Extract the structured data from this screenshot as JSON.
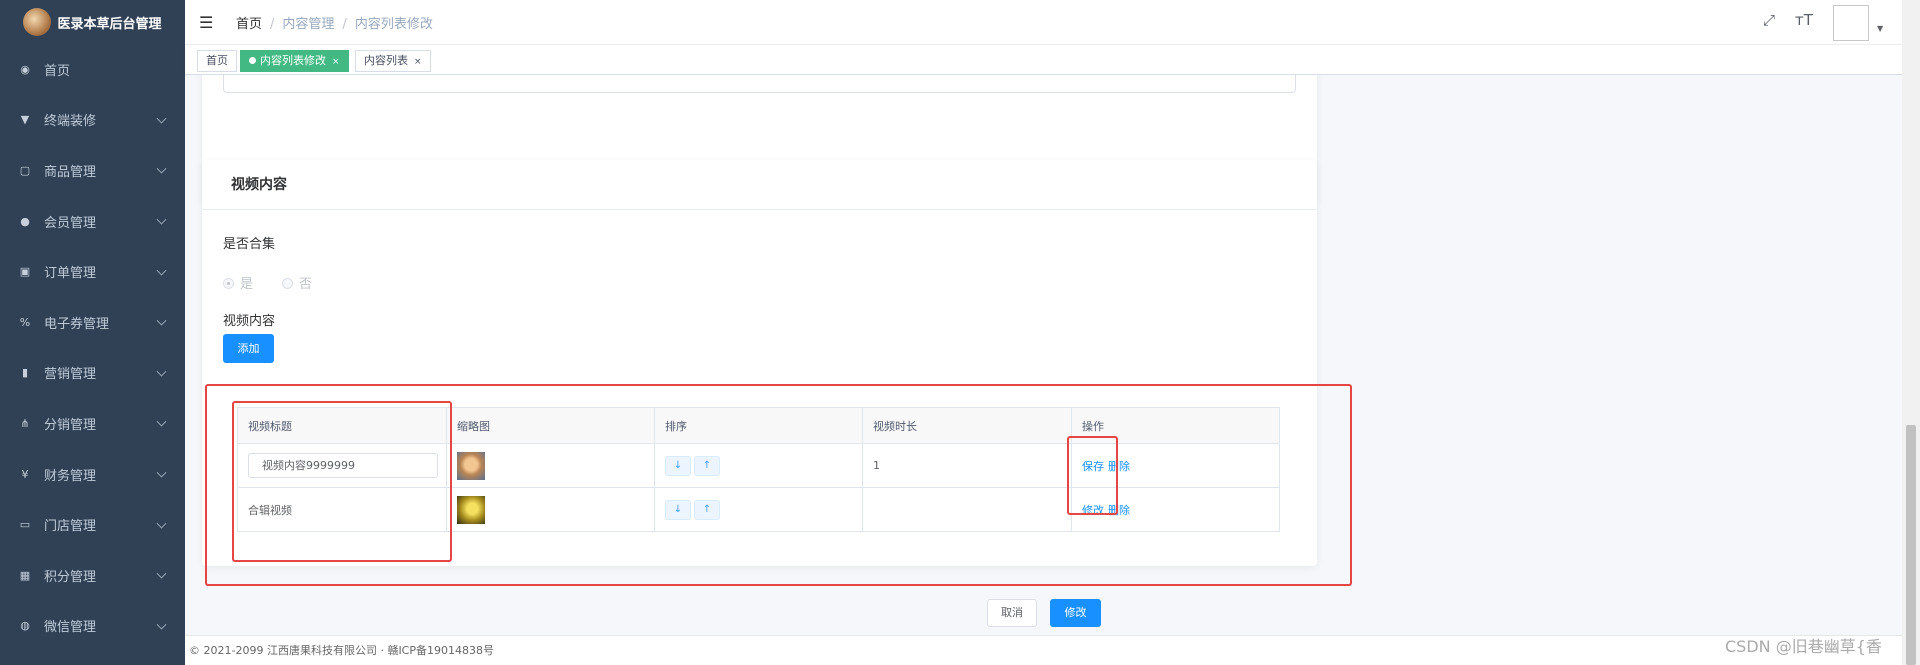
{
  "sidebar": {
    "title": "医录本草后台管理",
    "items": [
      {
        "label": "首页",
        "icon": "dashboard-icon",
        "glyph": "◉"
      },
      {
        "label": "终端装修",
        "icon": "shirt-icon",
        "glyph": "▼"
      },
      {
        "label": "商品管理",
        "icon": "goods-icon",
        "glyph": "▢"
      },
      {
        "label": "会员管理",
        "icon": "users-icon",
        "glyph": "●"
      },
      {
        "label": "订单管理",
        "icon": "lock-icon",
        "glyph": "▣"
      },
      {
        "label": "电子券管理",
        "icon": "coupon-icon",
        "glyph": "%"
      },
      {
        "label": "营销管理",
        "icon": "bar-chart-icon",
        "glyph": "▮"
      },
      {
        "label": "分销管理",
        "icon": "share-icon",
        "glyph": "⋔"
      },
      {
        "label": "财务管理",
        "icon": "finance-icon",
        "glyph": "¥"
      },
      {
        "label": "门店管理",
        "icon": "store-icon",
        "glyph": "▭"
      },
      {
        "label": "积分管理",
        "icon": "calendar-icon",
        "glyph": "▦"
      },
      {
        "label": "微信管理",
        "icon": "wechat-icon",
        "glyph": "◍"
      }
    ]
  },
  "navbar": {
    "breadcrumb": [
      "首页",
      "内容管理",
      "内容列表修改"
    ],
    "icons": [
      "fullscreen-icon",
      "font-size-icon"
    ],
    "fullscreen_glyph": "⤢",
    "fontsize_glyph": "тT",
    "caret_glyph": "▼"
  },
  "tags": [
    {
      "label": "首页",
      "active": false
    },
    {
      "label": "内容列表修改",
      "active": true,
      "close": "×"
    },
    {
      "label": "内容列表",
      "active": false,
      "close": "×"
    }
  ],
  "video_section": {
    "title": "视频内容",
    "collection_label": "是否合集",
    "radio_yes": "是",
    "radio_no": "否",
    "content_label": "视频内容",
    "add_button": "添加",
    "table": {
      "headers": [
        "视频标题",
        "缩略图",
        "排序",
        "视频时长",
        "操作"
      ],
      "rows": [
        {
          "title": "视频内容9999999",
          "editable": true,
          "duration": "1",
          "action1": "保存",
          "action2": "删除"
        },
        {
          "title": "合辑视频",
          "editable": false,
          "duration": "",
          "action1": "修改",
          "action2": "删除"
        }
      ],
      "sort_down": "↓",
      "sort_up": "↑"
    }
  },
  "form_actions": {
    "cancel": "取消",
    "submit": "修改"
  },
  "footer": {
    "text": "© 2021-2099 江西唐果科技有限公司 · 赣ICP备19014838号"
  },
  "watermark": "CSDN @旧巷幽草{香",
  "colors": {
    "sidebar_bg": "#304156",
    "primary": "#1890ff",
    "tag_active": "#42b983",
    "annotation_red": "#e54545"
  }
}
